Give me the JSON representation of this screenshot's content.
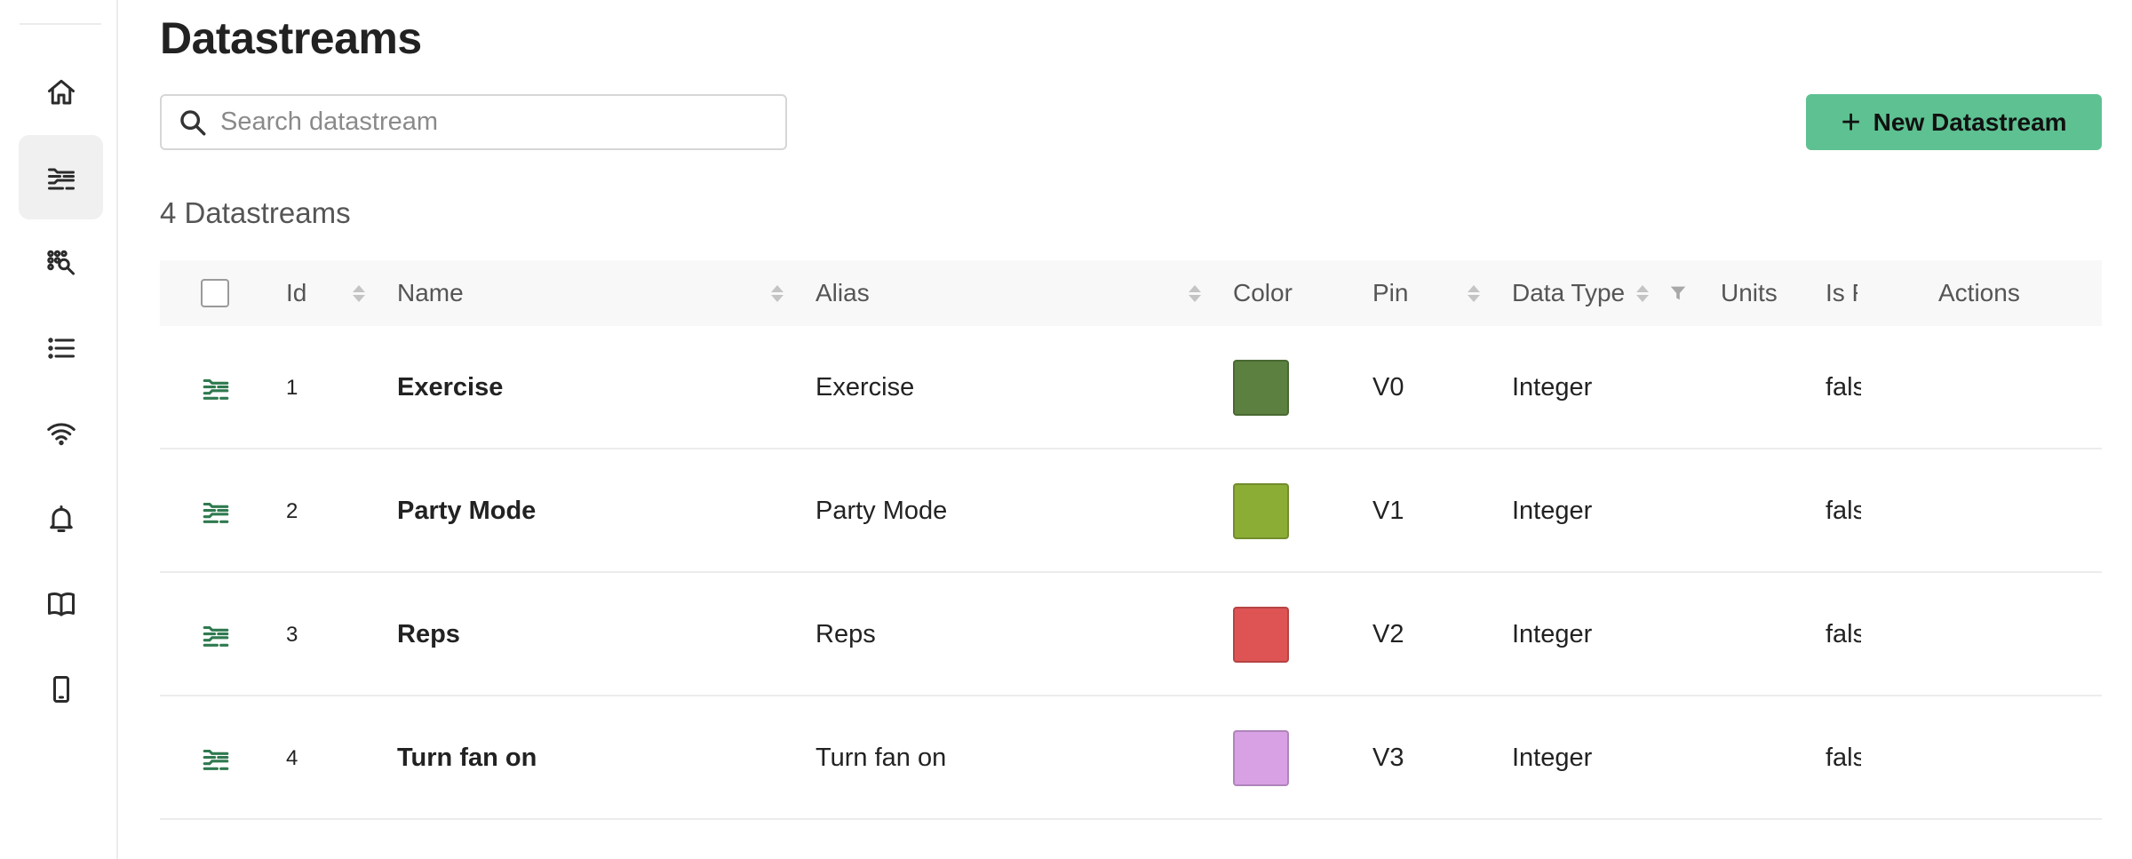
{
  "page": {
    "title": "Datastreams",
    "count_label": "4 Datastreams"
  },
  "search": {
    "placeholder": "Search datastream",
    "value": ""
  },
  "actions": {
    "new_label": "New Datastream",
    "new_color": "#5ec191"
  },
  "sidebar": {
    "items": [
      {
        "icon": "home-icon",
        "active": false
      },
      {
        "icon": "datastreams-icon",
        "active": true
      },
      {
        "icon": "automation-icon",
        "active": false
      },
      {
        "icon": "list-icon",
        "active": false
      },
      {
        "icon": "wifi-icon",
        "active": false
      },
      {
        "icon": "bell-icon",
        "active": false
      },
      {
        "icon": "book-icon",
        "active": false
      },
      {
        "icon": "mobile-icon",
        "active": false
      }
    ]
  },
  "table": {
    "headers": {
      "id": "Id",
      "name": "Name",
      "alias": "Alias",
      "color": "Color",
      "pin": "Pin",
      "data_type": "Data Type",
      "units": "Units",
      "is_raw": "Is Raw",
      "actions": "Actions"
    },
    "rows": [
      {
        "id": "1",
        "name": "Exercise",
        "alias": "Exercise",
        "color": "#5b803f",
        "pin": "V0",
        "data_type": "Integer",
        "units": "",
        "is_raw": "false"
      },
      {
        "id": "2",
        "name": "Party Mode",
        "alias": "Party Mode",
        "color": "#8bad36",
        "pin": "V1",
        "data_type": "Integer",
        "units": "",
        "is_raw": "false"
      },
      {
        "id": "3",
        "name": "Reps",
        "alias": "Reps",
        "color": "#de5454",
        "pin": "V2",
        "data_type": "Integer",
        "units": "",
        "is_raw": "false"
      },
      {
        "id": "4",
        "name": "Turn fan on",
        "alias": "Turn fan on",
        "color": "#d7a1e4",
        "pin": "V3",
        "data_type": "Integer",
        "units": "",
        "is_raw": "false"
      }
    ]
  }
}
